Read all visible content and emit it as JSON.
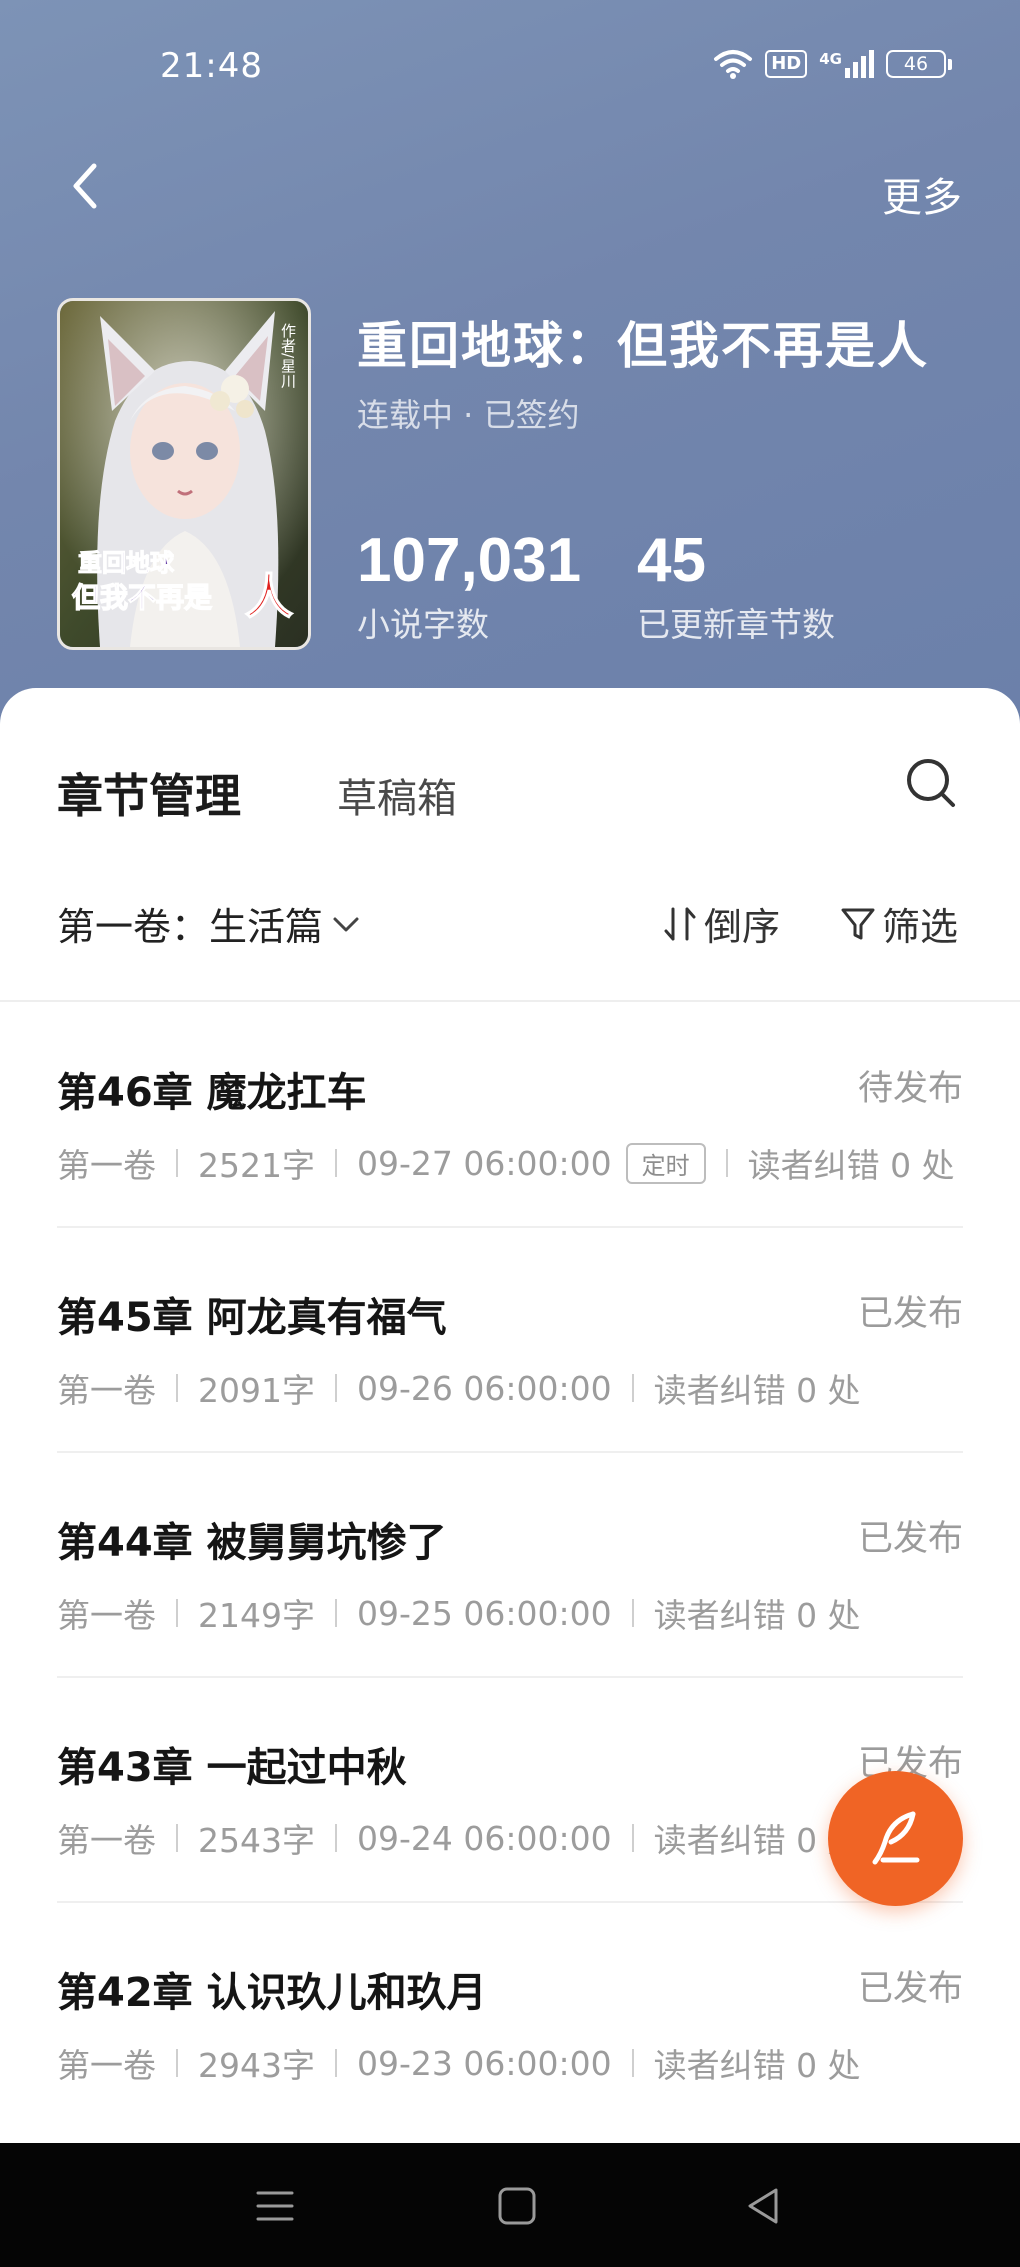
{
  "status_bar": {
    "time": "21:48",
    "network": "4G",
    "hd": "HD",
    "battery": "46",
    "icons": [
      "wifi-icon",
      "hd-icon",
      "signal-4g-icon",
      "battery-icon"
    ]
  },
  "nav": {
    "back_icon": "chevron-left-icon",
    "more_label": "更多"
  },
  "book": {
    "cover_alt_text": "重回地球 但我不再是人",
    "title": "重回地球：但我不再是人",
    "status": "连载中 · 已签约",
    "word_count": "107,031",
    "word_count_label": "小说字数",
    "chapters_count": "45",
    "chapters_count_label": "已更新章节数"
  },
  "tabs": {
    "active": "章节管理",
    "drafts": "草稿箱",
    "search_icon": "search-icon"
  },
  "toolbar": {
    "volume": "第一卷：生活篇",
    "sort": "倒序",
    "filter": "筛选"
  },
  "chapters": [
    {
      "title": "第46章 魔龙扛车",
      "state": "待发布",
      "volume": "第一卷",
      "words": "2521字",
      "time": "09-27 06:00:00",
      "tag": "定时",
      "errata": "读者纠错 0 处"
    },
    {
      "title": "第45章 阿龙真有福气",
      "state": "已发布",
      "volume": "第一卷",
      "words": "2091字",
      "time": "09-26 06:00:00",
      "tag": "",
      "errata": "读者纠错 0 处"
    },
    {
      "title": "第44章 被舅舅坑惨了",
      "state": "已发布",
      "volume": "第一卷",
      "words": "2149字",
      "time": "09-25 06:00:00",
      "tag": "",
      "errata": "读者纠错 0 处"
    },
    {
      "title": "第43章 一起过中秋",
      "state": "已发布",
      "volume": "第一卷",
      "words": "2543字",
      "time": "09-24 06:00:00",
      "tag": "",
      "errata": "读者纠错 0 处"
    },
    {
      "title": "第42章 认识玖儿和玖月",
      "state": "已发布",
      "volume": "第一卷",
      "words": "2943字",
      "time": "09-23 06:00:00",
      "tag": "",
      "errata": "读者纠错 0 处"
    }
  ],
  "fab": {
    "icon": "quill-pen-icon"
  },
  "system_nav": [
    "menu-icon",
    "home-square-icon",
    "back-triangle-icon"
  ],
  "colors": {
    "header": "#7386ad",
    "accent": "#f06425",
    "text_primary": "#151515",
    "text_secondary": "#9c9c9c"
  }
}
